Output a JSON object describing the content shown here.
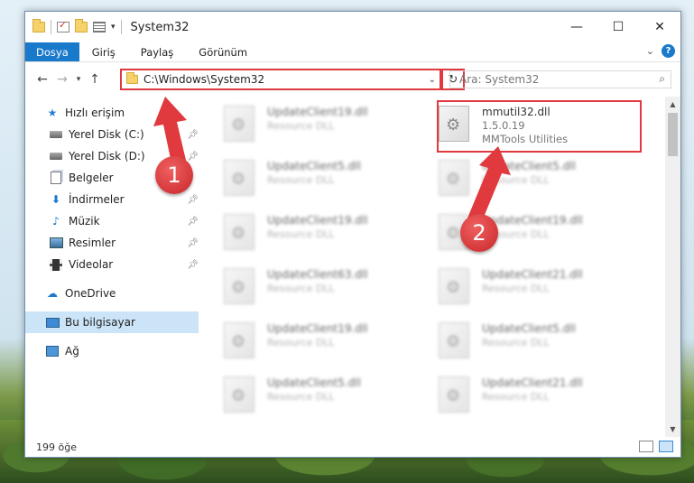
{
  "window": {
    "title": "System32",
    "controls": {
      "minimize": "—",
      "maximize": "☐",
      "close": "✕"
    }
  },
  "ribbon": {
    "tabs": [
      {
        "label": "Dosya",
        "active": true
      },
      {
        "label": "Giriş"
      },
      {
        "label": "Paylaş"
      },
      {
        "label": "Görünüm"
      }
    ],
    "help": "?"
  },
  "address": {
    "path": "C:\\Windows\\System32",
    "search_placeholder": "Ara: System32"
  },
  "sidebar": {
    "quick_access": "Hızlı erişim",
    "items": [
      {
        "label": "Yerel Disk (C:)",
        "icon": "disk-icon"
      },
      {
        "label": "Yerel Disk (D:)",
        "icon": "disk-icon"
      },
      {
        "label": "Belgeler",
        "icon": "documents-icon"
      },
      {
        "label": "İndirmeler",
        "icon": "download-icon"
      },
      {
        "label": "Müzik",
        "icon": "music-icon"
      },
      {
        "label": "Resimler",
        "icon": "pictures-icon"
      },
      {
        "label": "Videolar",
        "icon": "videos-icon"
      }
    ],
    "onedrive": "OneDrive",
    "this_pc": "Bu bilgisayar",
    "network": "Ağ"
  },
  "files": {
    "left": [
      {
        "name": "UpdateClient19.dll",
        "desc": "Resource DLL"
      },
      {
        "name": "UpdateClient5.dll",
        "desc": "Resource DLL"
      },
      {
        "name": "UpdateClient19.dll",
        "desc": "Resource DLL"
      },
      {
        "name": "UpdateClient63.dll",
        "desc": "Resource DLL"
      },
      {
        "name": "UpdateClient19.dll",
        "desc": "Resource DLL"
      },
      {
        "name": "UpdateClient5.dll",
        "desc": "Resource DLL"
      }
    ],
    "highlighted": {
      "name": "mmutil32.dll",
      "version": "1.5.0.19",
      "company": "MMTools Utilities"
    },
    "right": [
      {
        "name": "UpdateClient5.dll",
        "desc": "Resource DLL"
      },
      {
        "name": "UpdateClient19.dll",
        "desc": "Resource DLL"
      },
      {
        "name": "UpdateClient21.dll",
        "desc": "Resource DLL"
      },
      {
        "name": "UpdateClient5.dll",
        "desc": "Resource DLL"
      },
      {
        "name": "UpdateClient21.dll",
        "desc": "Resource DLL"
      }
    ]
  },
  "status": {
    "item_count": "199 öğe"
  },
  "annotations": {
    "step1": "1",
    "step2": "2",
    "color": "#e0393e"
  }
}
